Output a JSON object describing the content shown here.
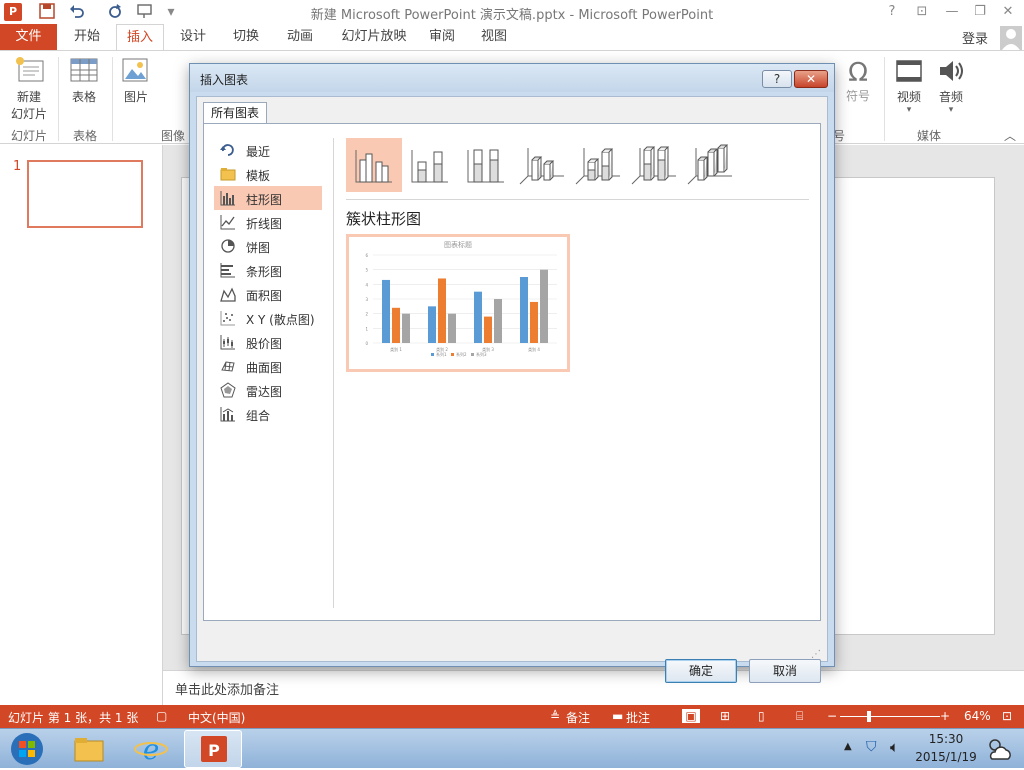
{
  "window": {
    "title": "新建 Microsoft PowerPoint 演示文稿.pptx - Microsoft PowerPoint",
    "help": "?",
    "login": "登录"
  },
  "tabs": [
    {
      "label": "文件"
    },
    {
      "label": "开始"
    },
    {
      "label": "插入"
    },
    {
      "label": "设计"
    },
    {
      "label": "切换"
    },
    {
      "label": "动画"
    },
    {
      "label": "幻灯片放映"
    },
    {
      "label": "审阅"
    },
    {
      "label": "视图"
    }
  ],
  "ribbon": {
    "new_slide_1": "新建",
    "new_slide_2": "幻灯片",
    "table": "表格",
    "picture": "图片",
    "symbol": "符号",
    "video": "视频",
    "audio": "音频",
    "groups": {
      "slides": "幻灯片",
      "tables": "表格",
      "images": "图像",
      "symbols": "号",
      "media": "媒体"
    }
  },
  "slide_thumb": {
    "number": "1"
  },
  "notes": {
    "placeholder": "单击此处添加备注"
  },
  "status": {
    "slide_info": "幻灯片 第 1 张，共 1 张",
    "language": "中文(中国)",
    "notes": "备注",
    "comments": "批注",
    "zoom": "64%"
  },
  "taskbar": {
    "time": "15:30",
    "date": "2015/1/19"
  },
  "dialog": {
    "title": "插入图表",
    "tab": "所有图表",
    "categories": [
      {
        "label": "最近",
        "icon": "recent-icon"
      },
      {
        "label": "模板",
        "icon": "folder-icon"
      },
      {
        "label": "柱形图",
        "icon": "column-chart-icon",
        "selected": true
      },
      {
        "label": "折线图",
        "icon": "line-chart-icon"
      },
      {
        "label": "饼图",
        "icon": "pie-chart-icon"
      },
      {
        "label": "条形图",
        "icon": "bar-chart-icon"
      },
      {
        "label": "面积图",
        "icon": "area-chart-icon"
      },
      {
        "label": "X Y (散点图)",
        "icon": "scatter-chart-icon"
      },
      {
        "label": "股价图",
        "icon": "stock-chart-icon"
      },
      {
        "label": "曲面图",
        "icon": "surface-chart-icon"
      },
      {
        "label": "雷达图",
        "icon": "radar-chart-icon"
      },
      {
        "label": "组合",
        "icon": "combo-chart-icon"
      }
    ],
    "selected_subtype": "簇状柱形图",
    "ok": "确定",
    "cancel": "取消"
  },
  "preview_chart": {
    "title": "图表标题",
    "categories": [
      "类别 1",
      "类别 2",
      "类别 3",
      "类别 4"
    ],
    "series": [
      {
        "name": "系列1",
        "color": "#5b9bd5",
        "values": [
          4.3,
          2.5,
          3.5,
          4.5
        ]
      },
      {
        "name": "系列2",
        "color": "#ed7d31",
        "values": [
          2.4,
          4.4,
          1.8,
          2.8
        ]
      },
      {
        "name": "系列3",
        "color": "#a5a5a5",
        "values": [
          2,
          2,
          3,
          5
        ]
      }
    ],
    "ylim": [
      0,
      6
    ],
    "yticks": [
      "0",
      "1",
      "2",
      "3",
      "4",
      "5",
      "6"
    ]
  },
  "colors": {
    "accent": "#d24726",
    "selection": "#f9c9b3"
  }
}
